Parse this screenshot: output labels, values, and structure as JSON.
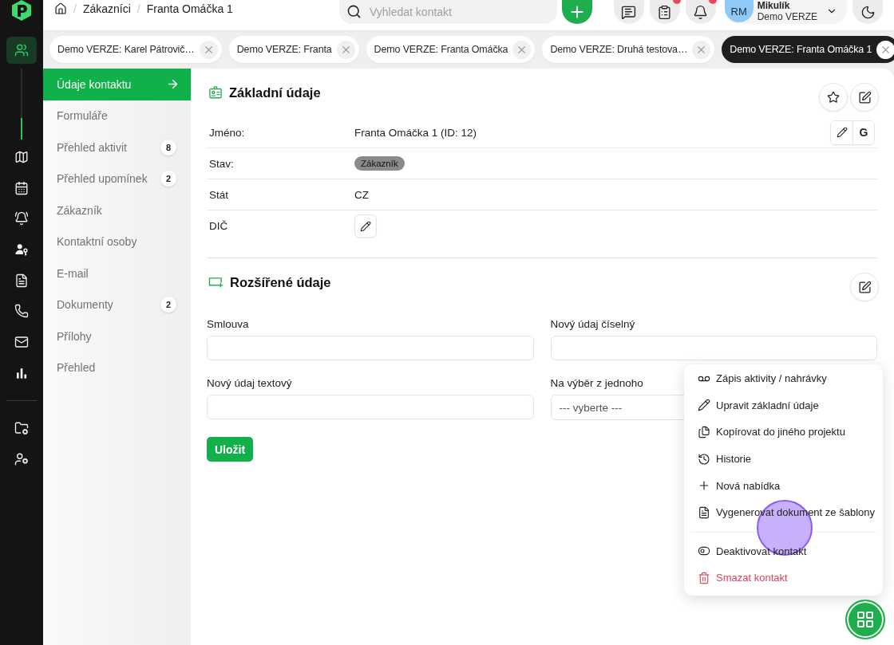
{
  "sidebar": {
    "nav": [
      {
        "kind": "contacts",
        "selected": true
      },
      {
        "kind": "map",
        "selected": false
      },
      {
        "kind": "calendar",
        "selected": false
      },
      {
        "kind": "alarm",
        "selected": false
      },
      {
        "kind": "user-key",
        "selected": false
      },
      {
        "kind": "document",
        "selected": false
      },
      {
        "kind": "phone",
        "selected": false
      },
      {
        "kind": "mail",
        "selected": false
      },
      {
        "kind": "stats",
        "selected": false
      }
    ],
    "bottom": [
      {
        "kind": "folder-settings",
        "selected": false
      },
      {
        "kind": "user-settings",
        "selected": false
      }
    ]
  },
  "header": {
    "breadcrumb": [
      {
        "kind": "separator",
        "text": "/"
      },
      {
        "kind": "link",
        "text": "Zákazníci"
      },
      {
        "kind": "separator",
        "text": "/"
      },
      {
        "kind": "current",
        "text": "Franta Omáčka 1"
      }
    ],
    "search": {
      "placeholder": "Vyhledat kontakt"
    },
    "tools": [
      {
        "kind": "messages",
        "badge": false
      },
      {
        "kind": "tasks",
        "badge": true
      },
      {
        "kind": "notifications",
        "badge": true
      }
    ],
    "user": {
      "initials": "RM",
      "name": "Mikulík",
      "project": "Demo VERZE"
    }
  },
  "tabs": [
    {
      "label": "Demo VERZE: Karel Pátrovič…",
      "selected": false
    },
    {
      "label": "Demo VERZE: Franta",
      "selected": false
    },
    {
      "label": "Demo VERZE: Franta Omáčka",
      "selected": false
    },
    {
      "label": "Demo VERZE: Druhá testova…",
      "selected": false
    },
    {
      "label": "Demo VERZE: Franta Omáčka 1",
      "selected": true
    }
  ],
  "contact_menu": [
    {
      "label": "Údaje kontaktu",
      "selected": true
    },
    {
      "label": "Formuláře",
      "selected": false
    },
    {
      "label": "Přehled aktivit",
      "count": "8",
      "selected": false
    },
    {
      "label": "Přehled upomínek",
      "count": "2",
      "selected": false
    },
    {
      "label": "Zákazník",
      "selected": false
    },
    {
      "label": "Kontaktní osoby",
      "selected": false
    },
    {
      "label": "E-mail",
      "selected": false
    },
    {
      "label": "Dokumenty",
      "count": "2",
      "selected": false
    },
    {
      "label": "Přílohy",
      "selected": false
    },
    {
      "label": "Přehled",
      "selected": false
    }
  ],
  "basic_info": {
    "title": "Základní údaje",
    "rows": [
      {
        "kind": "name",
        "label": "Jméno:",
        "value": "Franta Omáčka 1 (ID: 12)",
        "lookup": "G"
      },
      {
        "kind": "tag",
        "label": "Stav:",
        "value": "Zákazník"
      },
      {
        "kind": "text",
        "label": "Stát",
        "value": "CZ"
      },
      {
        "kind": "edit",
        "label": "DIČ"
      }
    ]
  },
  "extended_info": {
    "title": "Rozšířené údaje",
    "fields": [
      {
        "kind": "input",
        "label": "Smlouva"
      },
      {
        "kind": "input",
        "label": "Nový údaj číselný"
      },
      {
        "kind": "input",
        "label": "Nový údaj textový"
      },
      {
        "kind": "select",
        "label": "Na výběr z jednoho",
        "value": "--- vyberte ---"
      }
    ],
    "save": "Uložit"
  },
  "action_menu": {
    "groups": [
      [
        {
          "kind": "record",
          "label": "Zápis aktivity / nahrávky",
          "danger": false
        },
        {
          "kind": "edit",
          "label": "Upravit základní údaje",
          "danger": false
        },
        {
          "kind": "copy",
          "label": "Kopírovat do jiného projektu",
          "danger": false
        },
        {
          "kind": "history",
          "label": "Historie",
          "danger": false
        },
        {
          "kind": "add",
          "label": "Nová nabídka",
          "danger": false
        },
        {
          "kind": "generate",
          "label": "Vygenerovat dokument ze šablony",
          "danger": false
        }
      ],
      [
        {
          "kind": "deactivate",
          "label": "Deaktivovat kontakt",
          "danger": false
        },
        {
          "kind": "delete",
          "label": "Smazat kontakt",
          "danger": true
        }
      ]
    ]
  }
}
